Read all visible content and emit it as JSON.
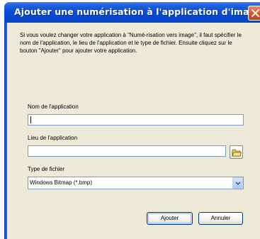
{
  "window": {
    "title": "Ajouter une numérisation à l'application d'image"
  },
  "intro": {
    "text": "Si vous voulez changer votre application à \"Numé-risation vers image\", il faut spécifier le nom de l'application, le lieu de l'application et le type de fichier. Ensuite cliquez sur le bouton \"Ajouter\" pour ajouter votre application."
  },
  "form": {
    "app_name": {
      "label": "Nom de l'application",
      "value": ""
    },
    "app_location": {
      "label": "Lieu de l'application",
      "value": ""
    },
    "file_type": {
      "label": "Type de fichier",
      "selected": "Windows Bitmap (*.bmp)"
    }
  },
  "buttons": {
    "add": "Ajouter",
    "cancel": "Annuler"
  },
  "icons": {
    "close": "close-icon",
    "browse": "folder-icon",
    "dropdown": "chevron-down-icon"
  },
  "colors": {
    "titlebar": "#0a4fd6",
    "client_background": "#ece9d8",
    "close_button": "#d75a36",
    "field_border": "#7f9db9"
  }
}
